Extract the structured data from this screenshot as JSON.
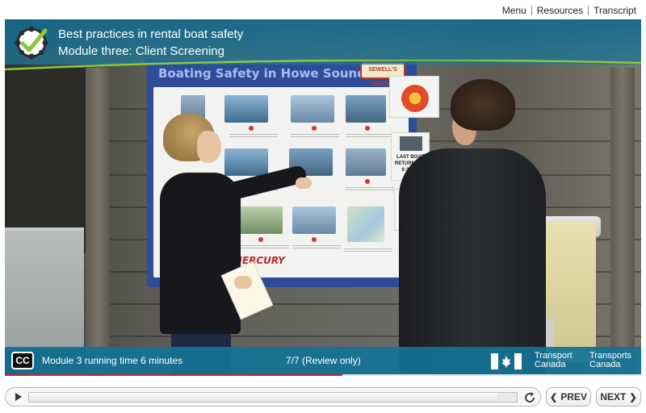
{
  "topnav": {
    "menu": "Menu",
    "resources": "Resources",
    "transcript": "Transcript"
  },
  "header": {
    "course_title": "Best practices in rental boat safety",
    "module_title": "Module three: Client Screening"
  },
  "scene": {
    "sign_title": "Boating Safety in Howe Sound",
    "sign_logo": "SEWELL'S MARINA",
    "sign_sponsor": "MERCURY",
    "last_boat_sign": "LAST BOAT RETURNS AT 6:30PM"
  },
  "bottombar": {
    "cc_label": "CC",
    "running_time": "Module 3 running time 6 minutes",
    "page_info": "7/7 (Review only)",
    "gov_en_line1": "Transport",
    "gov_en_line2": "Canada",
    "gov_fr_line1": "Transports",
    "gov_fr_line2": "Canada"
  },
  "playback": {
    "timeline_progress": 0.53,
    "seek_progress": 0.96
  },
  "nav": {
    "prev_label": "PREV",
    "next_label": "NEXT"
  },
  "icons": {
    "play": "play-icon",
    "replay": "replay-icon",
    "prev": "chevron-left-icon",
    "next": "chevron-right-icon",
    "logo": "checkmark-badge-icon",
    "flag": "canada-flag-icon"
  },
  "colors": {
    "header_bg": "#1e7896",
    "bottombar_bg": "#147396",
    "accent_green": "#8cc63f",
    "progress_red": "#d8202a",
    "board_blue": "#2d4d9a"
  }
}
